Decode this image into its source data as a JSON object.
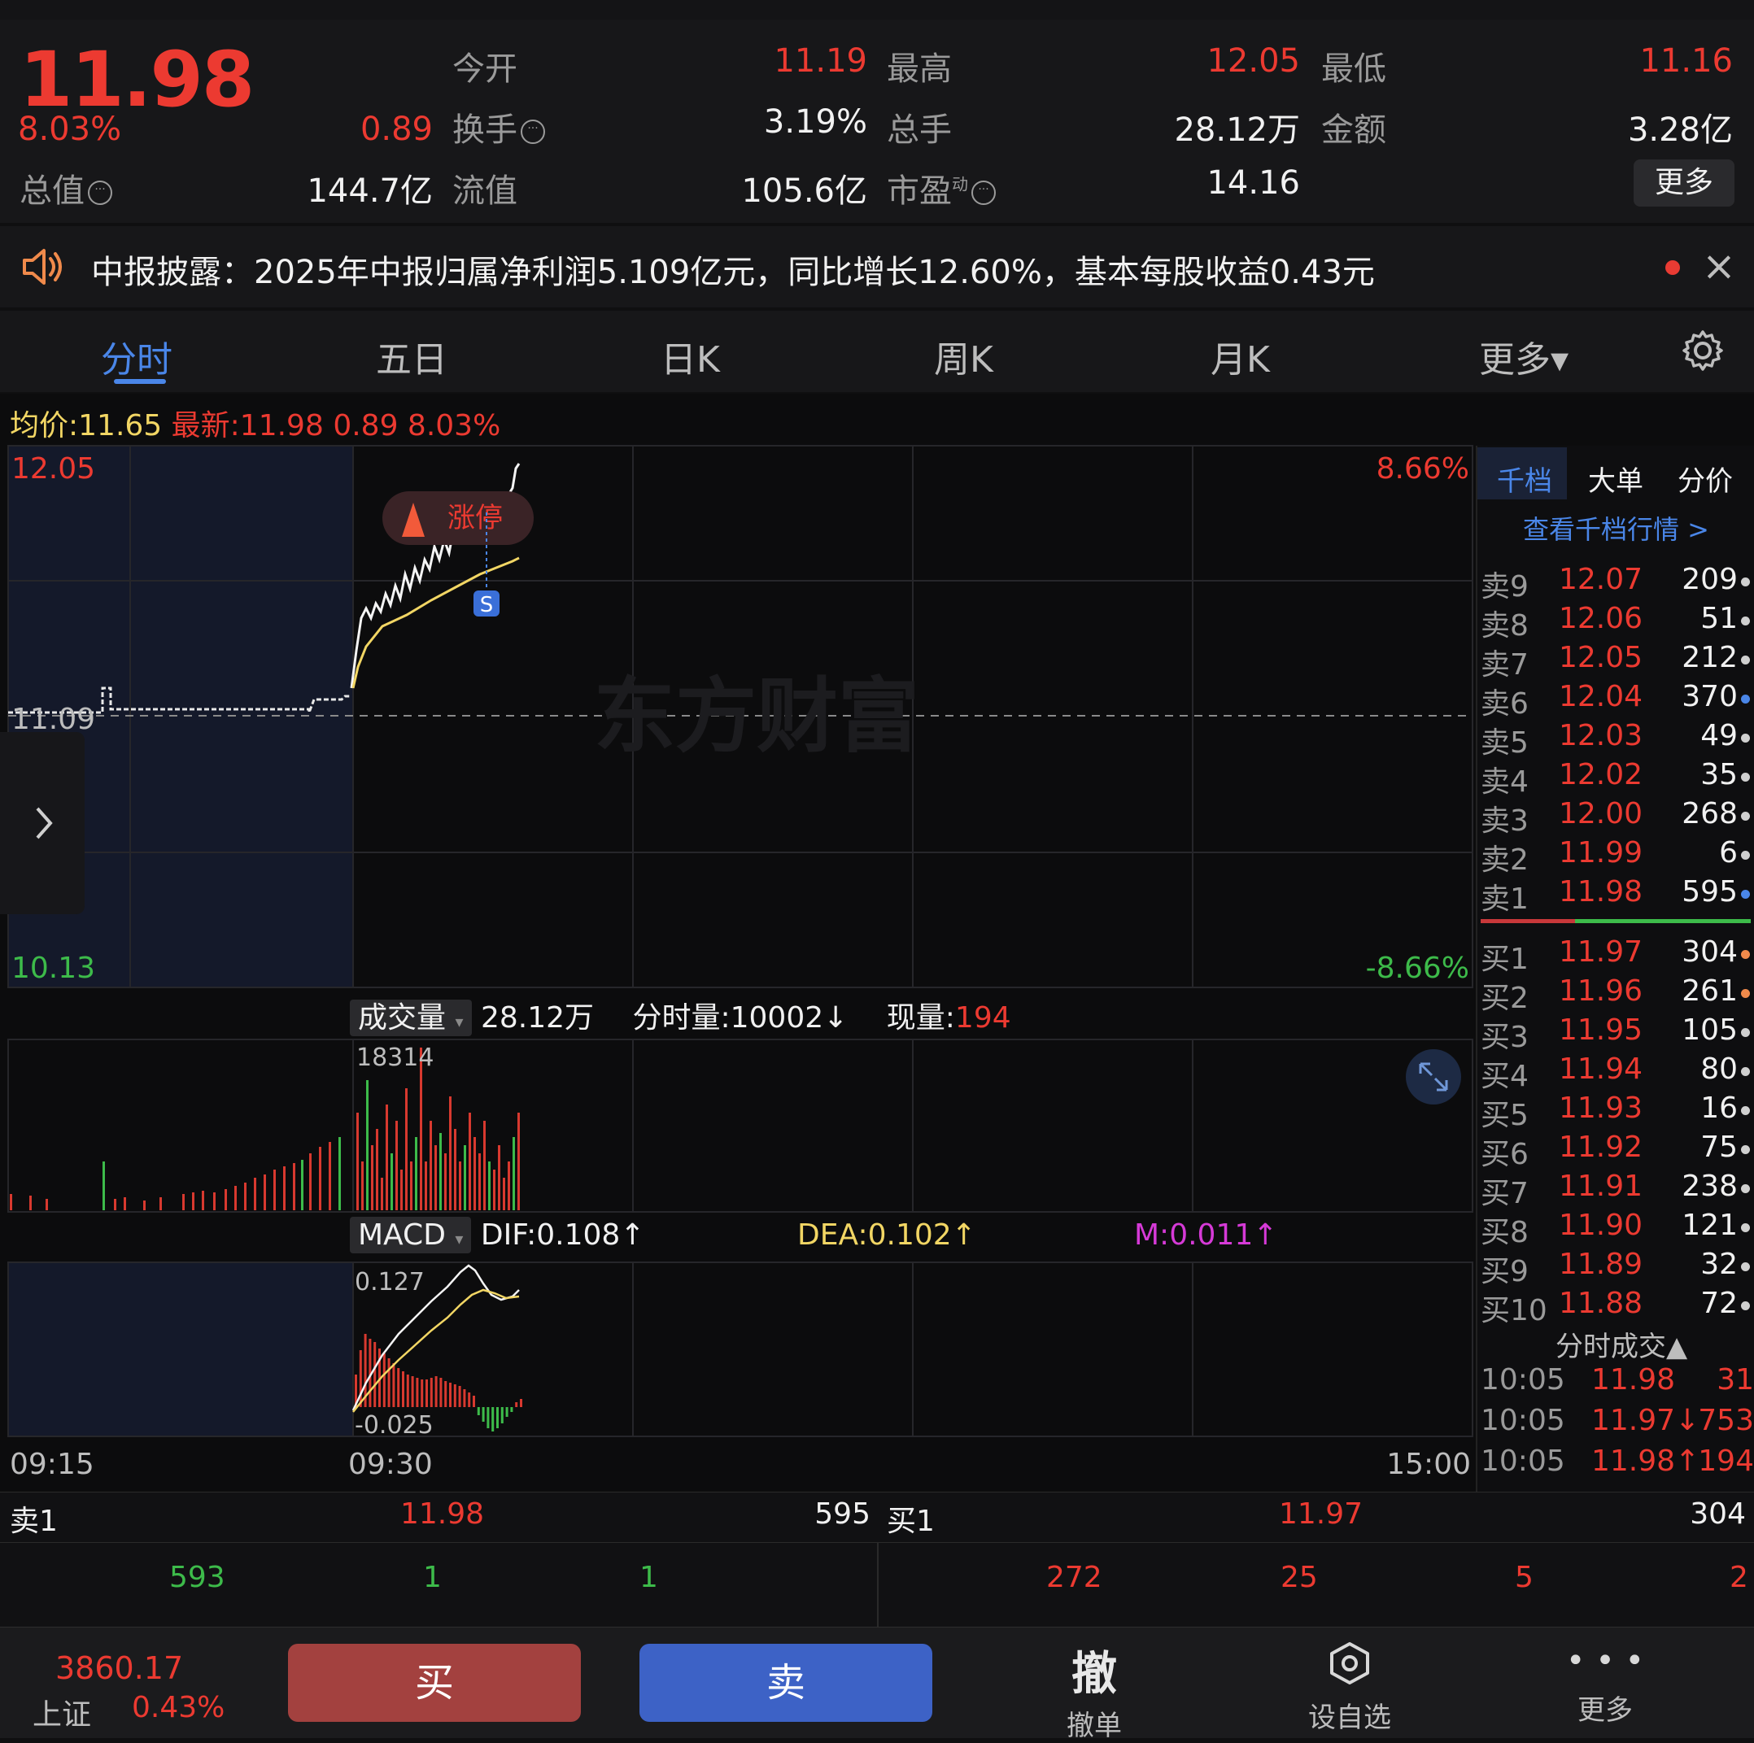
{
  "quote": {
    "price": "11.98",
    "change_pct": "8.03%",
    "change_abs": "0.89",
    "open_label": "今开",
    "open_value": "11.19",
    "high_label": "最高",
    "high_value": "12.05",
    "low_label": "最低",
    "low_value": "11.16",
    "turnover_label": "换手",
    "turnover_value": "3.19%",
    "volume_label": "总手",
    "volume_value": "28.12万",
    "amount_label": "金额",
    "amount_value": "3.28亿",
    "mktcap_label": "总值",
    "mktcap_value": "144.7亿",
    "float_label": "流值",
    "float_value": "105.6亿",
    "pe_label": "市盈",
    "pe_sup": "动",
    "pe_value": "14.16",
    "more_label": "更多"
  },
  "notice": {
    "text": "中报披露：2025年中报归属净利润5.109亿元，同比增长12.60%，基本每股收益0.43元",
    "close_icon": "×"
  },
  "tabs": [
    "分时",
    "五日",
    "日K",
    "周K",
    "月K",
    "更多▾"
  ],
  "legend": {
    "avg_label": "均价:",
    "avg_value": "11.65",
    "latest_label": "最新:",
    "latest_value": "11.98",
    "chg": "0.89",
    "pct": "8.03%"
  },
  "chart_labels": {
    "top_price": "12.05",
    "bottom_price": "10.13",
    "prev_close": "11.09",
    "top_pct": "8.66%",
    "bottom_pct": "-8.66%",
    "limit_up_tag": "涨停",
    "s_marker": "S",
    "watermark": "东方财富",
    "time_start": "09:15",
    "time_mid": "09:30",
    "time_end": "15:00"
  },
  "volume_panel": {
    "selector": "成交量",
    "total": "28.12万",
    "minute_label": "分时量:",
    "minute_value": "10002",
    "now_label": "现量:",
    "now_value": "194",
    "max_label": "18314"
  },
  "macd_panel": {
    "selector": "MACD",
    "dif": "DIF:0.108",
    "dea": "DEA:0.102",
    "m": "M:0.011",
    "top_label": "0.127",
    "bottom_label": "-0.025"
  },
  "orderbook": {
    "tabs": [
      "千档",
      "大单",
      "分价"
    ],
    "link": "查看千档行情 >",
    "asks": [
      {
        "label": "卖9",
        "price": "12.07",
        "vol": "209"
      },
      {
        "label": "卖8",
        "price": "12.06",
        "vol": "51"
      },
      {
        "label": "卖7",
        "price": "12.05",
        "vol": "212"
      },
      {
        "label": "卖6",
        "price": "12.04",
        "vol": "370"
      },
      {
        "label": "卖5",
        "price": "12.03",
        "vol": "49"
      },
      {
        "label": "卖4",
        "price": "12.02",
        "vol": "35"
      },
      {
        "label": "卖3",
        "price": "12.00",
        "vol": "268"
      },
      {
        "label": "卖2",
        "price": "11.99",
        "vol": "6"
      },
      {
        "label": "卖1",
        "price": "11.98",
        "vol": "595"
      }
    ],
    "bids": [
      {
        "label": "买1",
        "price": "11.97",
        "vol": "304"
      },
      {
        "label": "买2",
        "price": "11.96",
        "vol": "261"
      },
      {
        "label": "买3",
        "price": "11.95",
        "vol": "105"
      },
      {
        "label": "买4",
        "price": "11.94",
        "vol": "80"
      },
      {
        "label": "买5",
        "price": "11.93",
        "vol": "16"
      },
      {
        "label": "买6",
        "price": "11.92",
        "vol": "75"
      },
      {
        "label": "买7",
        "price": "11.91",
        "vol": "238"
      },
      {
        "label": "买8",
        "price": "11.90",
        "vol": "121"
      },
      {
        "label": "买9",
        "price": "11.89",
        "vol": "32"
      },
      {
        "label": "买10",
        "price": "11.88",
        "vol": "72"
      }
    ],
    "trades_title": "分时成交▲",
    "trades": [
      {
        "time": "10:05",
        "price": "11.98",
        "vol": "31"
      },
      {
        "time": "10:05",
        "price": "11.97↓",
        "vol": "753"
      },
      {
        "time": "10:05",
        "price": "11.98↑",
        "vol": "194"
      }
    ]
  },
  "book_row": {
    "ask_label": "卖1",
    "ask_price": "11.98",
    "ask_vol": "595",
    "bid_label": "买1",
    "bid_price": "11.97",
    "bid_vol": "304",
    "ask_queue": [
      "593",
      "1",
      "1"
    ],
    "bid_queue": [
      "272",
      "25",
      "5",
      "2"
    ]
  },
  "bottom_bar": {
    "index_value": "3860.17",
    "index_name": "上证",
    "index_pct": "0.43%",
    "buy": "买",
    "sell": "卖",
    "cancel_glyph": "撤",
    "cancel_label": "撤单",
    "watch_label": "设自选",
    "more_label": "更多"
  },
  "colors": {
    "up": "#ec3a31",
    "down": "#3dbb4a",
    "accent": "#4a86e8",
    "avg_line": "#f2d664"
  }
}
